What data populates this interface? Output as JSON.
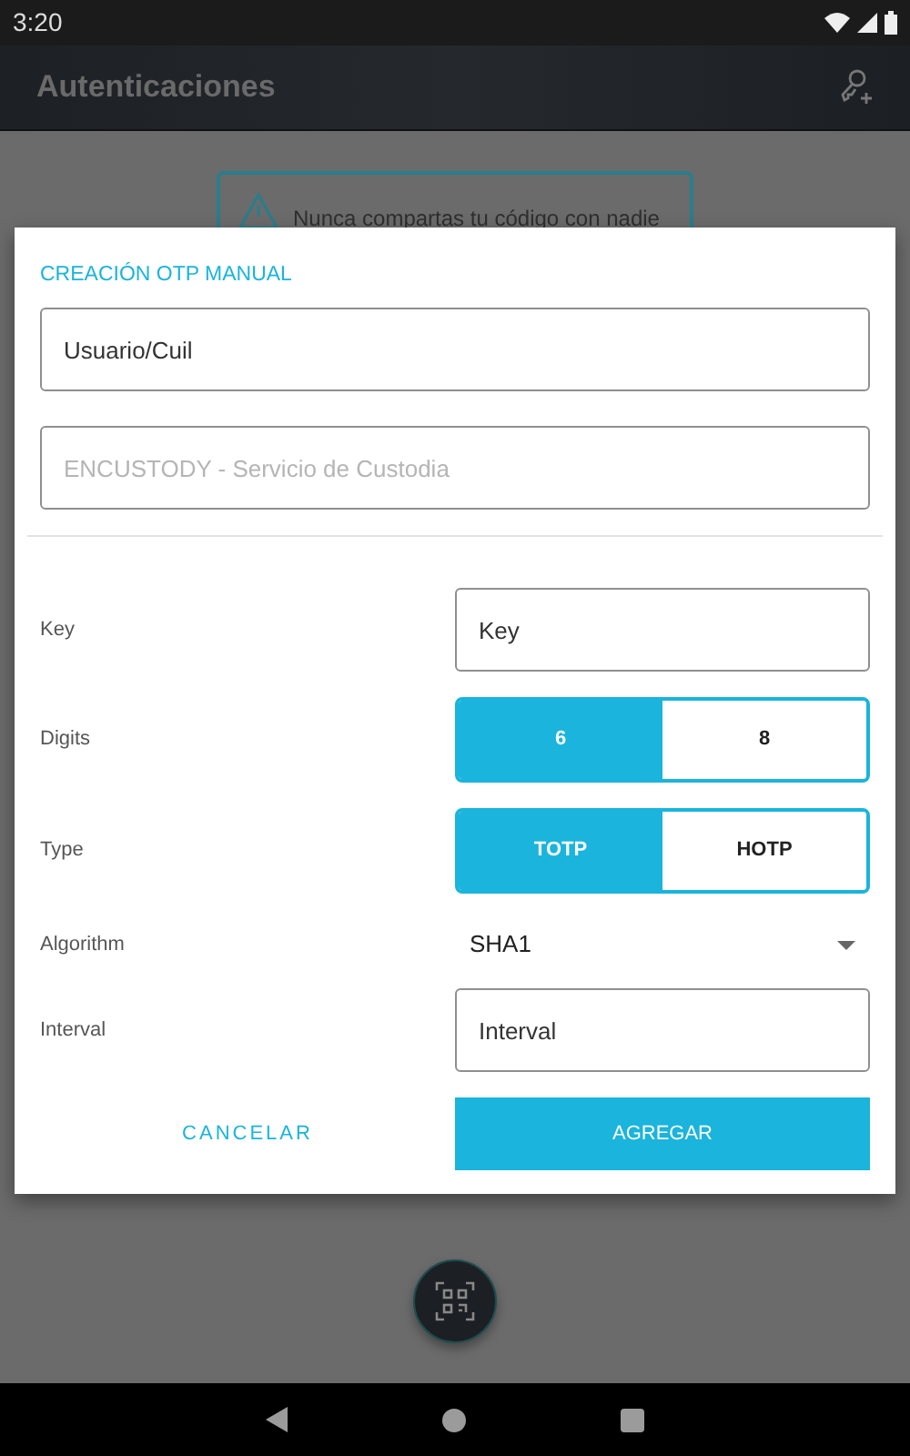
{
  "status_bar": {
    "time": "3:20"
  },
  "app_bar": {
    "title": "Autenticaciones"
  },
  "notice": {
    "text": "Nunca compartas tu código con nadie"
  },
  "dialog": {
    "title": "CREACIÓN OTP MANUAL",
    "user_field": {
      "value": "Usuario/Cuil"
    },
    "service_field": {
      "placeholder": "ENCUSTODY - Servicio de Custodia"
    },
    "rows": [
      {
        "kind": "input",
        "label": "Key",
        "value": "Key"
      },
      {
        "kind": "segmented",
        "label": "Digits",
        "options": [
          {
            "label": "6",
            "selected": true
          },
          {
            "label": "8",
            "selected": false
          }
        ]
      },
      {
        "kind": "segmented",
        "label": "Type",
        "options": [
          {
            "label": "TOTP",
            "selected": true
          },
          {
            "label": "HOTP",
            "selected": false
          }
        ]
      },
      {
        "kind": "dropdown",
        "label": "Algorithm",
        "value": "SHA1"
      },
      {
        "kind": "input",
        "label": "Interval",
        "value": "Interval"
      }
    ],
    "buttons": [
      {
        "label": "CANCELAR",
        "kind": "text"
      },
      {
        "label": "AGREGAR",
        "kind": "filled"
      }
    ]
  }
}
